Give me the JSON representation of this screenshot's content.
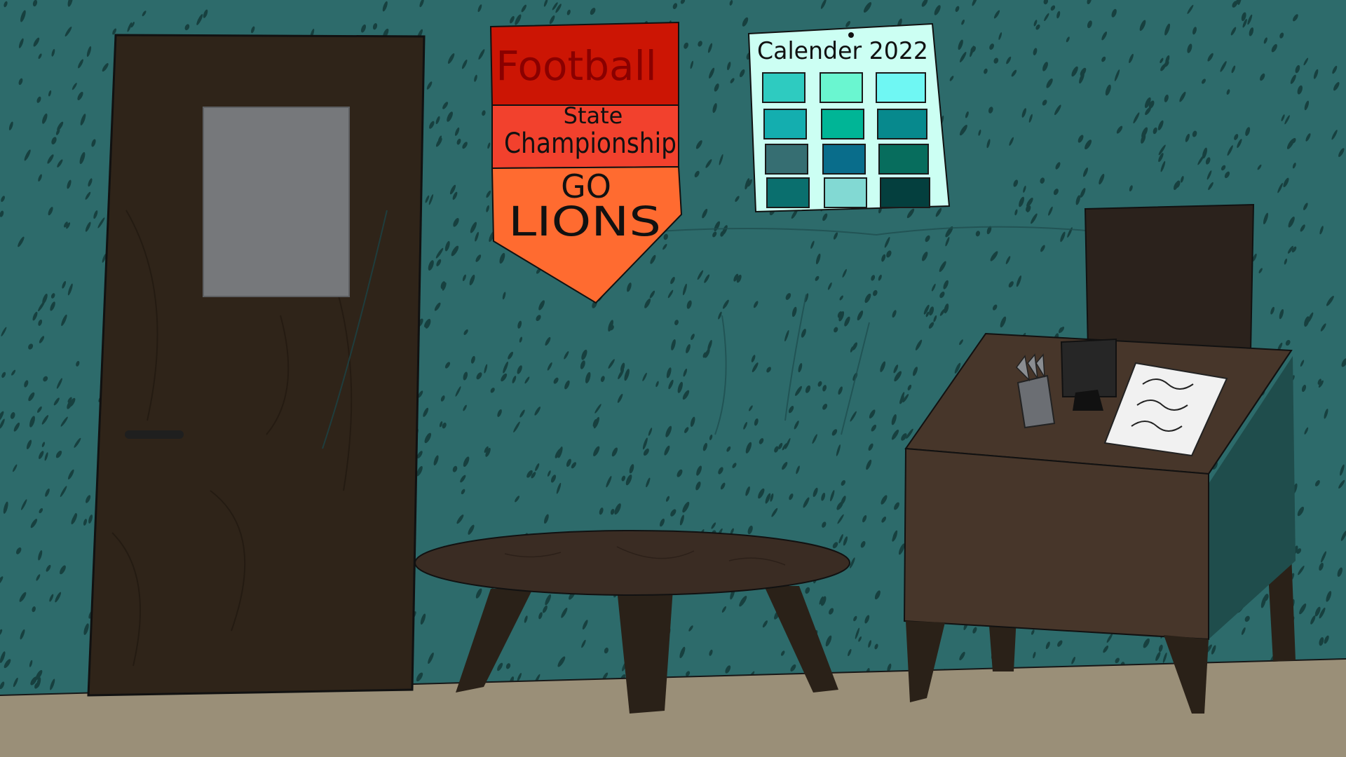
{
  "scene": {
    "wall_color": "#2d6b6b",
    "wall_speckle_color": "#17403f",
    "floor_color": "#9a8f78",
    "wood_dark": "#2f2419",
    "desk_wood": "#47362a"
  },
  "pennant": {
    "line1": "Football",
    "line2": "State",
    "line3": "Championship",
    "line4": "GO",
    "line5": "LIONS",
    "colors": [
      "#cc1504",
      "#f2412d",
      "#ff6b30"
    ]
  },
  "calendar": {
    "title": "Calender 2022",
    "paper_color": "#ccfff3",
    "month_colors": [
      "#2ecbc0",
      "#6af6d0",
      "#6ff7f3",
      "#14aeaf",
      "#00b596",
      "#07898d",
      "#366e72",
      "#096d8b",
      "#076d5d",
      "#0a6f6e",
      "#82d9d3",
      "#043f3e"
    ]
  },
  "door": {
    "window_color": "#76787b"
  },
  "desk": {
    "paper_scribbles": 3
  }
}
